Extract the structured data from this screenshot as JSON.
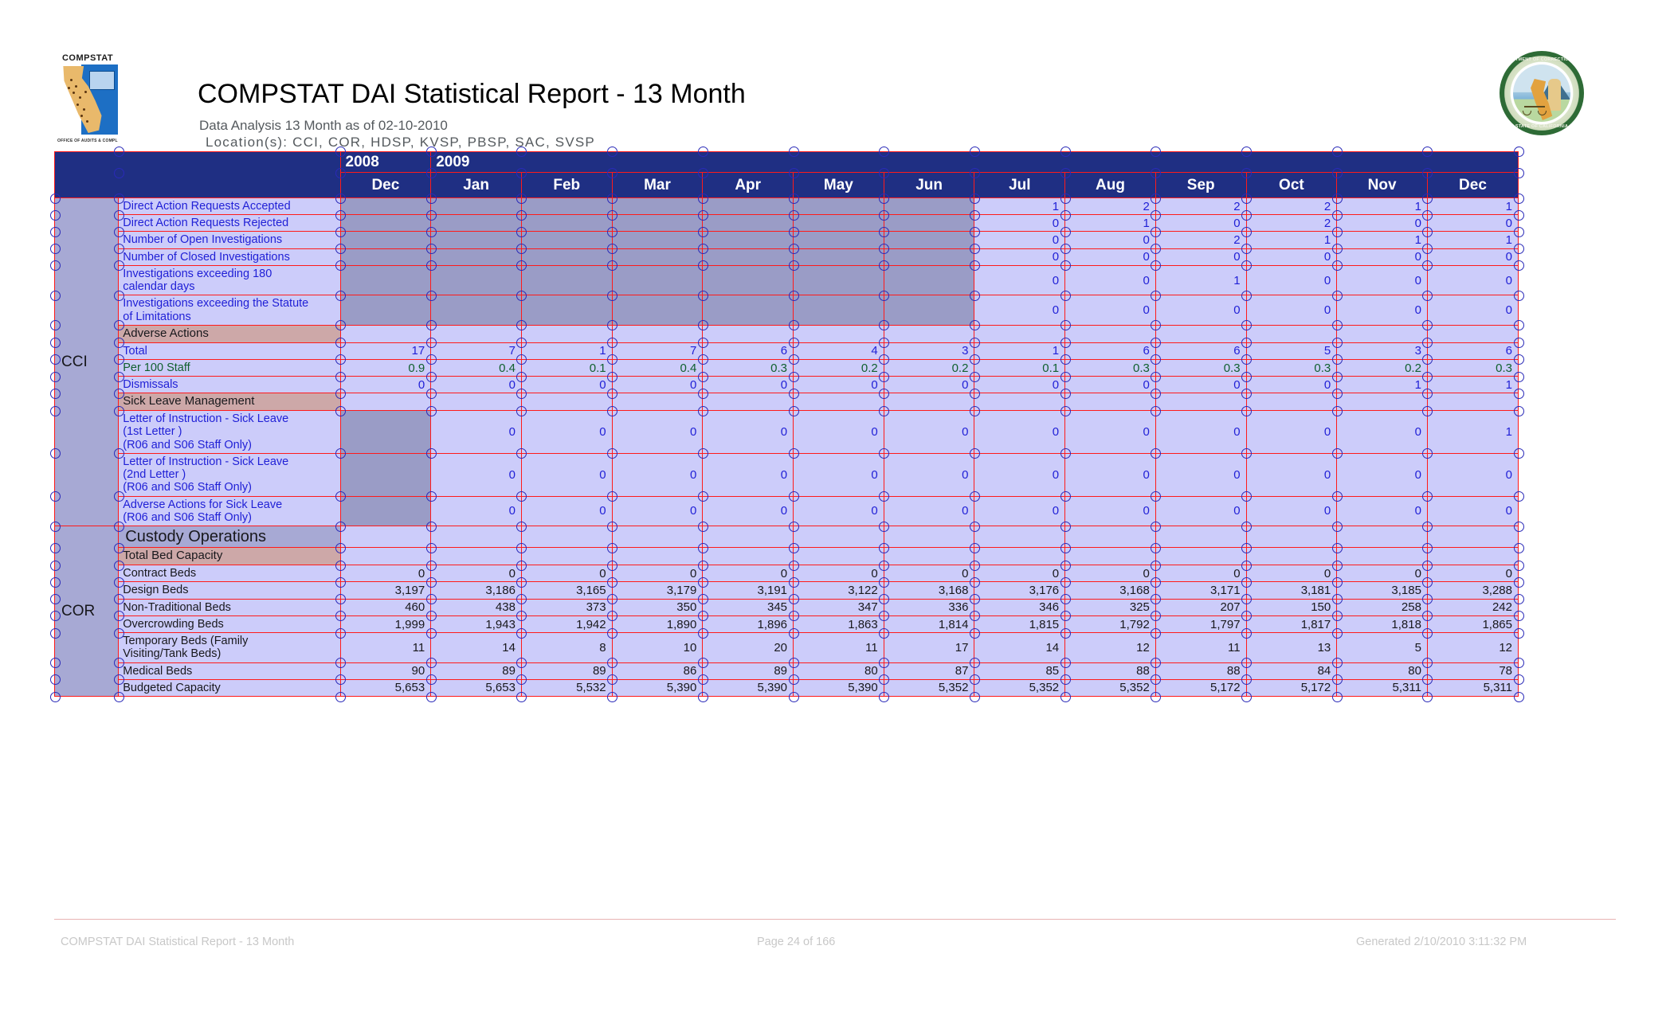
{
  "header": {
    "title": "COMPSTAT DAI Statistical Report - 13 Month",
    "subtitle": "Data Analysis 13 Month as of 02-10-2010",
    "locations": "Location(s):   CCI,  COR,  HDSP,  KVSP,  PBSP,  SAC,  SVSP",
    "compstat_logo_word": "COMPSTAT",
    "compstat_logo_sub": "OFFICE OF AUDITS & COMPLIANCE",
    "seal_text_top": "DEPARTMENT OF CORRECTIONS AND REHABILITATION",
    "seal_text_bottom": "STATE OF CALIFORNIA"
  },
  "table": {
    "years": [
      {
        "label": "2008",
        "span": 1
      },
      {
        "label": "2009",
        "span": 12
      }
    ],
    "months": [
      "Dec",
      "Jan",
      "Feb",
      "Mar",
      "Apr",
      "May",
      "Jun",
      "Jul",
      "Aug",
      "Sep",
      "Oct",
      "Nov",
      "Dec"
    ],
    "location_cci": "CCI",
    "location_cor": "COR",
    "rows": [
      {
        "label": "Direct Action Requests Accepted",
        "style": "blue",
        "values": [
          "",
          "",
          "",
          "",
          "",
          "",
          "",
          "1",
          "2",
          "2",
          "2",
          "1",
          "1"
        ],
        "grey_cols": 7
      },
      {
        "label": "Direct Action Requests Rejected",
        "style": "blue",
        "values": [
          "",
          "",
          "",
          "",
          "",
          "",
          "",
          "0",
          "1",
          "0",
          "2",
          "0",
          "0"
        ],
        "grey_cols": 7
      },
      {
        "label": "Number of Open Investigations",
        "style": "blue",
        "values": [
          "",
          "",
          "",
          "",
          "",
          "",
          "",
          "0",
          "0",
          "2",
          "1",
          "1",
          "1"
        ],
        "grey_cols": 7
      },
      {
        "label": "Number of Closed Investigations",
        "style": "blue",
        "values": [
          "",
          "",
          "",
          "",
          "",
          "",
          "",
          "0",
          "0",
          "0",
          "0",
          "0",
          "0"
        ],
        "grey_cols": 7
      },
      {
        "label": "Investigations exceeding 180\ncalendar days",
        "style": "blue",
        "values": [
          "",
          "",
          "",
          "",
          "",
          "",
          "",
          "0",
          "0",
          "1",
          "0",
          "0",
          "0"
        ],
        "grey_cols": 7
      },
      {
        "label": "Investigations exceeding the Statute\nof Limitations",
        "style": "blue",
        "values": [
          "",
          "",
          "",
          "",
          "",
          "",
          "",
          "0",
          "0",
          "0",
          "0",
          "0",
          "0"
        ],
        "grey_cols": 7
      },
      {
        "label": "Adverse Actions",
        "style": "section",
        "values": [
          "",
          "",
          "",
          "",
          "",
          "",
          "",
          "",
          "",
          "",
          "",
          "",
          ""
        ],
        "grey_cols": 0
      },
      {
        "label": "Total",
        "style": "blue",
        "values": [
          "17",
          "7",
          "1",
          "7",
          "6",
          "4",
          "3",
          "1",
          "6",
          "6",
          "5",
          "3",
          "6"
        ],
        "grey_cols": 0
      },
      {
        "label": "Per 100 Staff",
        "style": "green",
        "values": [
          "0.9",
          "0.4",
          "0.1",
          "0.4",
          "0.3",
          "0.2",
          "0.2",
          "0.1",
          "0.3",
          "0.3",
          "0.3",
          "0.2",
          "0.3"
        ],
        "grey_cols": 0
      },
      {
        "label": "Dismissals",
        "style": "blue",
        "values": [
          "0",
          "0",
          "0",
          "0",
          "0",
          "0",
          "0",
          "0",
          "0",
          "0",
          "0",
          "1",
          "1"
        ],
        "grey_cols": 0
      },
      {
        "label": "Sick Leave Management",
        "style": "section",
        "values": [
          "",
          "",
          "",
          "",
          "",
          "",
          "",
          "",
          "",
          "",
          "",
          "",
          ""
        ],
        "grey_cols": 0
      },
      {
        "label": "Letter of Instruction - Sick Leave\n(1st Letter )\n(R06 and S06 Staff Only)",
        "style": "blue",
        "values": [
          "",
          "0",
          "0",
          "0",
          "0",
          "0",
          "0",
          "0",
          "0",
          "0",
          "0",
          "0",
          "1"
        ],
        "grey_cols": 1
      },
      {
        "label": "Letter of Instruction - Sick Leave\n(2nd Letter )\n(R06 and S06 Staff Only)",
        "style": "blue",
        "values": [
          "",
          "0",
          "0",
          "0",
          "0",
          "0",
          "0",
          "0",
          "0",
          "0",
          "0",
          "0",
          "0"
        ],
        "grey_cols": 1
      },
      {
        "label": "Adverse Actions for Sick Leave\n(R06 and S06 Staff Only)",
        "style": "blue",
        "values": [
          "",
          "0",
          "0",
          "0",
          "0",
          "0",
          "0",
          "0",
          "0",
          "0",
          "0",
          "0",
          "0"
        ],
        "grey_cols": 1
      },
      {
        "label": "Custody Operations",
        "style": "subhead",
        "values": [
          "",
          "",
          "",
          "",
          "",
          "",
          "",
          "",
          "",
          "",
          "",
          "",
          ""
        ],
        "grey_cols": 0
      },
      {
        "label": "Total Bed Capacity",
        "style": "section",
        "values": [
          "",
          "",
          "",
          "",
          "",
          "",
          "",
          "",
          "",
          "",
          "",
          "",
          ""
        ],
        "grey_cols": 0
      },
      {
        "label": "Contract Beds",
        "style": "black",
        "values": [
          "0",
          "0",
          "0",
          "0",
          "0",
          "0",
          "0",
          "0",
          "0",
          "0",
          "0",
          "0",
          "0"
        ],
        "grey_cols": 0
      },
      {
        "label": "Design Beds",
        "style": "black",
        "values": [
          "3,197",
          "3,186",
          "3,165",
          "3,179",
          "3,191",
          "3,122",
          "3,168",
          "3,176",
          "3,168",
          "3,171",
          "3,181",
          "3,185",
          "3,288"
        ],
        "grey_cols": 0
      },
      {
        "label": "Non-Traditional Beds",
        "style": "black",
        "values": [
          "460",
          "438",
          "373",
          "350",
          "345",
          "347",
          "336",
          "346",
          "325",
          "207",
          "150",
          "258",
          "242"
        ],
        "grey_cols": 0
      },
      {
        "label": "Overcrowding Beds",
        "style": "black",
        "values": [
          "1,999",
          "1,943",
          "1,942",
          "1,890",
          "1,896",
          "1,863",
          "1,814",
          "1,815",
          "1,792",
          "1,797",
          "1,817",
          "1,818",
          "1,865"
        ],
        "grey_cols": 0
      },
      {
        "label": "Temporary Beds (Family\nVisiting/Tank Beds)",
        "style": "black",
        "values": [
          "11",
          "14",
          "8",
          "10",
          "20",
          "11",
          "17",
          "14",
          "12",
          "11",
          "13",
          "5",
          "12"
        ],
        "grey_cols": 0
      },
      {
        "label": "Medical Beds",
        "style": "black",
        "values": [
          "90",
          "89",
          "89",
          "86",
          "89",
          "80",
          "87",
          "85",
          "88",
          "88",
          "84",
          "80",
          "78"
        ],
        "grey_cols": 0
      },
      {
        "label": "Budgeted Capacity",
        "style": "black",
        "values": [
          "5,653",
          "5,653",
          "5,532",
          "5,390",
          "5,390",
          "5,390",
          "5,352",
          "5,352",
          "5,352",
          "5,172",
          "5,172",
          "5,311",
          "5,311"
        ],
        "grey_cols": 0
      }
    ],
    "cci_row_count": 14
  },
  "footer": {
    "left": "COMPSTAT DAI Statistical Report - 13 Month",
    "center": "Page 24 of 166",
    "right": "Generated 2/10/2010 3:11:32 PM"
  },
  "colors": {
    "header_band": "#1f2f83",
    "grid_line": "#ff1a1a",
    "cell_bg": "#ccccfa",
    "cell_bg_grey": "#9a9cc6",
    "section_bg": "#cda8a8",
    "loc_bg": "#a7a9d4",
    "text_blue": "#1f1fd6",
    "text_green": "#10602e",
    "handle_stroke": "#2a2ab8"
  }
}
